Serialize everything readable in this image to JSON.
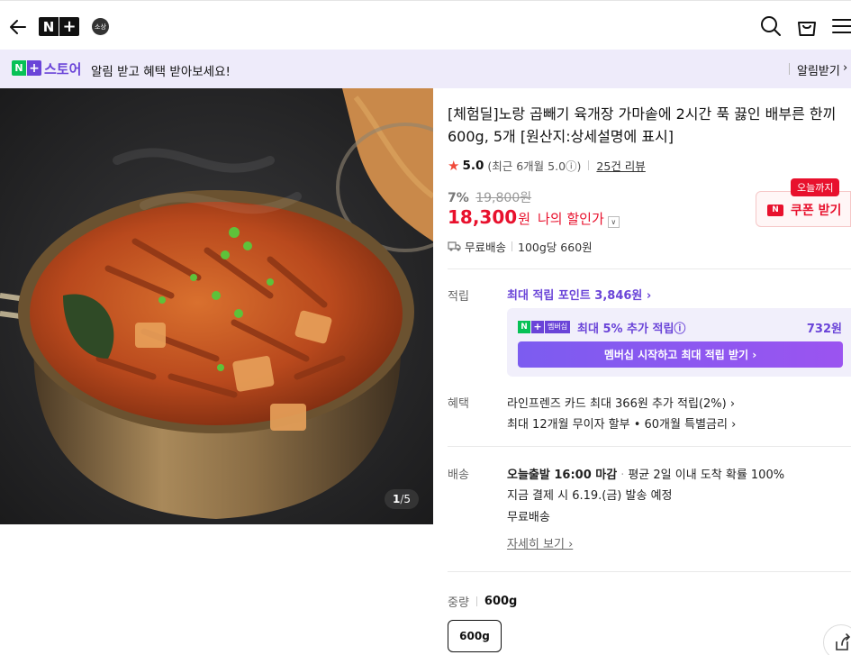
{
  "header": {
    "back_icon": "arrow-left-icon",
    "logo": {
      "n": "N",
      "plus": "+"
    },
    "seal_text": "소상",
    "icons": [
      "search-icon",
      "shopping-bag-icon",
      "menu-icon"
    ]
  },
  "banner": {
    "badge_n": "N",
    "badge_plus": "+",
    "store_label": "스토어",
    "message": "알림 받고 혜택 받아보세요!",
    "alarm_label": "알림받기",
    "alarm_chevron": "›",
    "bg_color": "#eeebfa",
    "accent": "#6a44d8"
  },
  "gallery": {
    "counter_current": "1",
    "counter_sep": "/",
    "counter_total": "5"
  },
  "product": {
    "title": "[체험딜]노랑 곱빼기 육개장 가마솥에 2시간 푹 끓인 배부른 한끼 600g, 5개 [원산지:상세설명에 표시]",
    "rating": {
      "star": "★",
      "score": "5.0",
      "recent": "(최근 6개월 5.0ⓘ)",
      "reviews": "25건 리뷰"
    },
    "discount_rate": "7%",
    "original_price": "19,800원",
    "price": "18,300",
    "price_unit": "원",
    "price_label": "나의 할인가",
    "price_dropdown": "∨",
    "coupon": {
      "today": "오늘까지",
      "n_tag": "N",
      "label": "쿠폰 받기",
      "chevron": "↓"
    },
    "shipping_free": "무료배송",
    "unit_price": "100g당 660원"
  },
  "points": {
    "label": "적립",
    "max_points": "최대 적립 포인트 3,846원 ›",
    "member": {
      "badge_n": "N",
      "badge_plus": "+",
      "badge_text": "멤버십",
      "text": "최대 5% 추가 적립ⓘ",
      "amount": "732원",
      "button": "멤버십 시작하고 최대 적립 받기 ›"
    }
  },
  "benefits": {
    "label": "혜택",
    "items": [
      "라인프렌즈 카드 최대 366원 추가 적립(2%) ›",
      "최대 12개월 무이자 할부 • 60개월 특별금리 ›"
    ]
  },
  "delivery": {
    "label": "배송",
    "deadline": "오늘출발 16:00 마감",
    "dot": "·",
    "probability": "평균 2일 이내 도착 확률 100%",
    "dispatch": "지금 결제 시 6.19.(금) 발송 예정",
    "fee": "무료배송",
    "detail_link": "자세히 보기 ›"
  },
  "option": {
    "label": "중량",
    "value": "600g",
    "button": "600g"
  },
  "share_icon": "share-icon",
  "colors": {
    "price_red": "#e8112d",
    "purple": "#6a44d8",
    "naver_green": "#07c156"
  }
}
